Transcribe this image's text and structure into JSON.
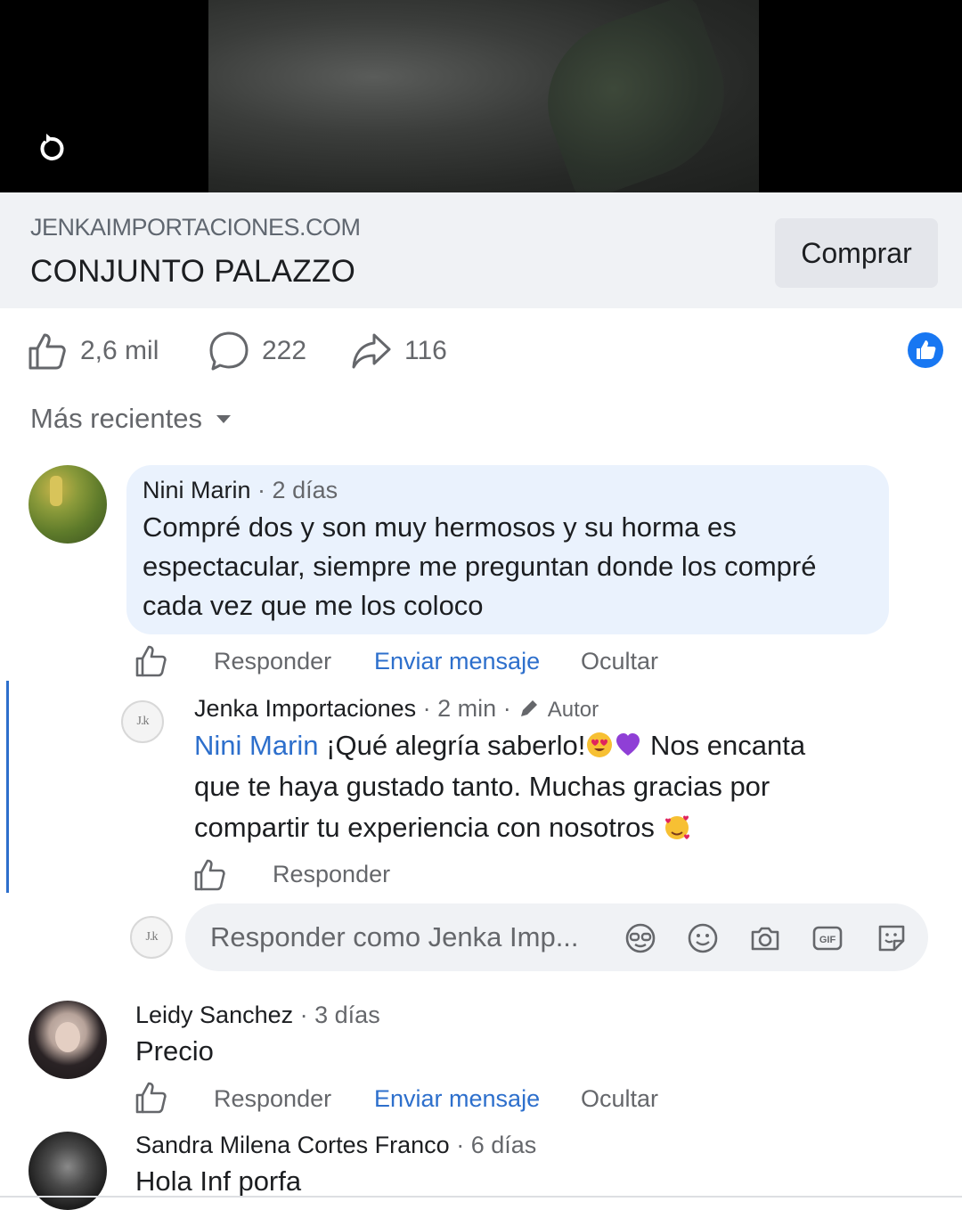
{
  "post": {
    "link_domain": "JENKAIMPORTACIONES.COM",
    "product_title": "CONJUNTO PALAZZO",
    "buy_label": "Comprar"
  },
  "stats": {
    "likes": "2,6 mil",
    "comments": "222",
    "shares": "116"
  },
  "sort": {
    "label": "Más recientes"
  },
  "comments": [
    {
      "author": "Nini Marin",
      "time": "2 días",
      "text_lines": [
        "Compré dos y son muy hermosos y su horma es",
        "espectacular, siempre me preguntan donde los compré",
        "cada vez que me los coloco"
      ],
      "actions": {
        "reply": "Responder",
        "message": "Enviar mensaje",
        "hide": "Ocultar"
      },
      "reply": {
        "author": "Jenka Importaciones",
        "time": "2 min",
        "badge": "Autor",
        "mention": "Nini Marin",
        "text_line1": "¡Qué alegría saberlo!",
        "text_line1_tail": "Nos encanta",
        "text_line2": "que te haya gustado tanto. Muchas gracias por",
        "text_line3": "compartir tu experiencia con nosotros",
        "reply_label": "Responder"
      }
    },
    {
      "author": "Leidy Sanchez",
      "time": "3 días",
      "text": "Precio",
      "actions": {
        "reply": "Responder",
        "message": "Enviar mensaje",
        "hide": "Ocultar"
      }
    },
    {
      "author": "Sandra Milena Cortes Franco",
      "time": "6 días",
      "text": "Hola Inf porfa"
    }
  ],
  "reply_box": {
    "placeholder": "Responder como Jenka Imp...",
    "icons": [
      "avatar-sticker-icon",
      "emoji-icon",
      "camera-icon",
      "gif-icon",
      "sticker-icon"
    ]
  },
  "page_avatar_text": "J.k",
  "colors": {
    "link_blue": "#2d6fcc",
    "bubble": "#eaf2fd",
    "muted": "#65676b",
    "like_badge": "#1877f2"
  }
}
